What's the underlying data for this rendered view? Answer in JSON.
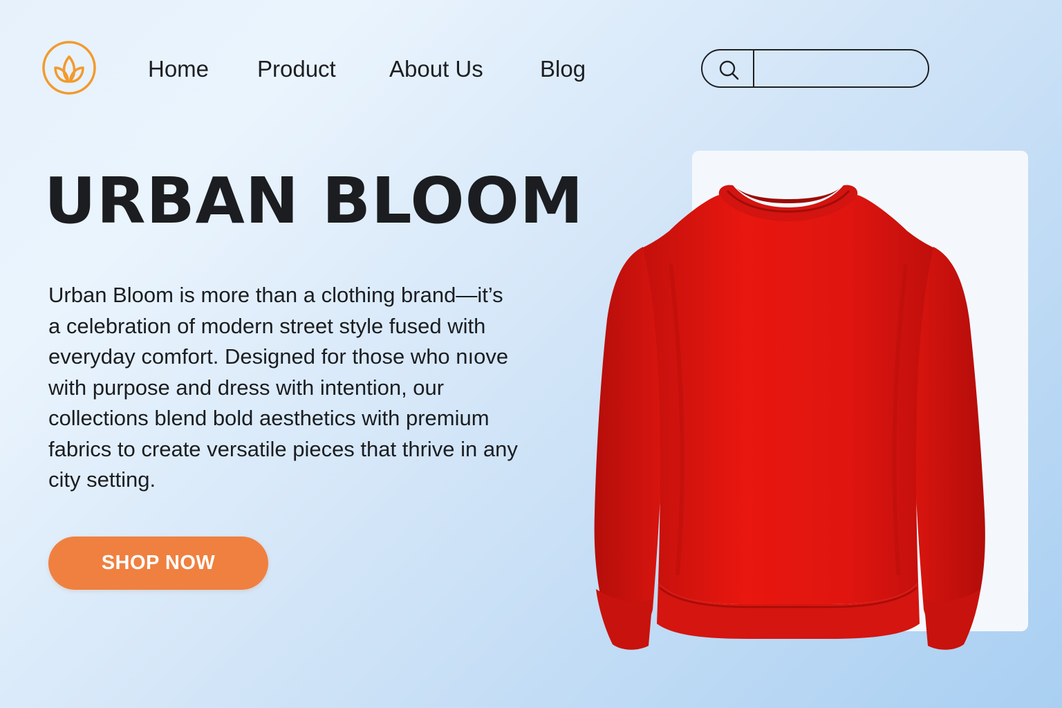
{
  "brand": {
    "logo_icon": "lotus-icon",
    "accent_color": "#f29a2e"
  },
  "nav": {
    "items": [
      {
        "label": "Home"
      },
      {
        "label": "Product"
      },
      {
        "label": "About Us"
      },
      {
        "label": "Blog"
      }
    ]
  },
  "search": {
    "icon": "search-icon",
    "placeholder": "",
    "value": ""
  },
  "hero": {
    "title": "URBAN BLOOM",
    "description": "Urban Bloom is more than a clothing brand—it’s a celebration of modern street style fused with everyday comfort. Designed for those who nıove with purpose and dress with intention, our collections blend bold aesthetics with premium fabrics to create versatile pieces that thrive in any city setting.",
    "cta_label": "SHOP NOW",
    "cta_color": "#ef8040"
  },
  "product": {
    "image_subject": "red crewneck sweatshirt",
    "color": "#e3160f"
  }
}
